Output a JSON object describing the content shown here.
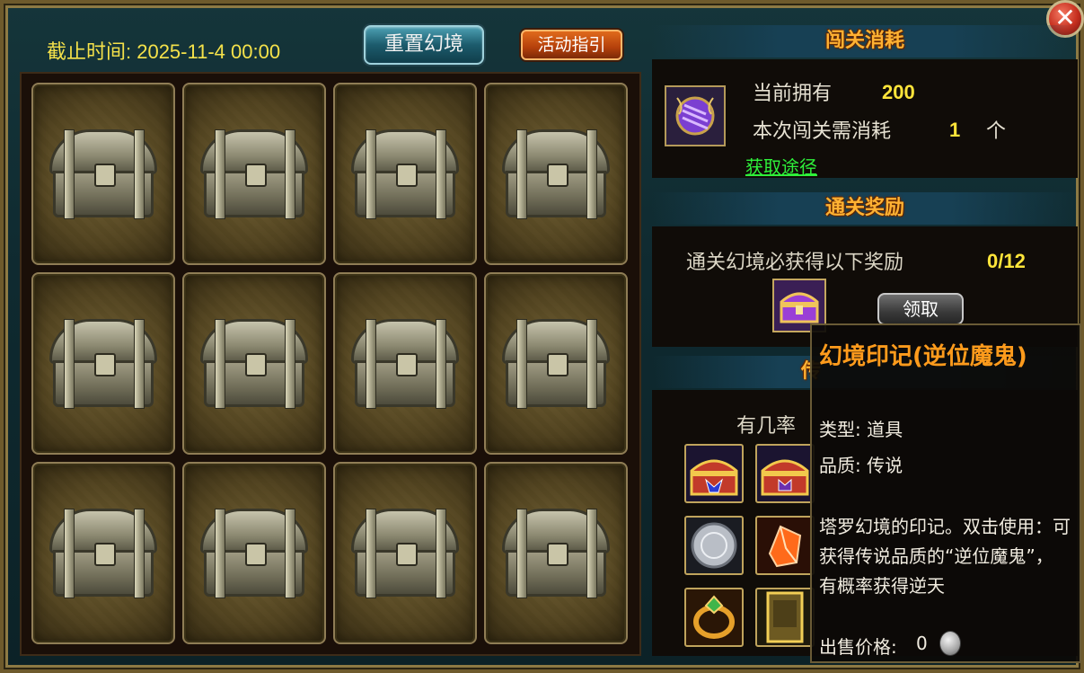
{
  "header": {
    "deadline": "截止时间: 2025-11-4 00:00",
    "reset_button": "重置幻境",
    "guide_button": "活动指引",
    "close_glyph": "✕"
  },
  "cost_section": {
    "title": "闯关消耗",
    "owned_label": "当前拥有",
    "owned_value": "200",
    "cost_label": "本次闯关需消耗",
    "cost_value": "1",
    "cost_unit": "个",
    "get_link": "获取途径",
    "item_icon": "purple-orb-seal-icon"
  },
  "reward_section": {
    "title": "通关奖励",
    "desc": "通关幻境必获得以下奖励",
    "progress": "0/12",
    "claim_button": "领取",
    "reward_icon": "purple-chest-icon"
  },
  "chance_section": {
    "title_visible": "传",
    "desc_visible": "有几率",
    "items": [
      {
        "icon": "gold-blue-chest-icon"
      },
      {
        "icon": "gold-purple-chest-icon"
      },
      {
        "icon": "silver-coin-icon"
      },
      {
        "icon": "orange-crystal-icon"
      },
      {
        "icon": "gold-ring-icon"
      },
      {
        "icon": "gold-card-icon"
      }
    ]
  },
  "chests": [
    {
      "icon": "chest-icon"
    },
    {
      "icon": "chest-icon"
    },
    {
      "icon": "chest-icon"
    },
    {
      "icon": "chest-icon"
    },
    {
      "icon": "chest-icon"
    },
    {
      "icon": "chest-icon"
    },
    {
      "icon": "chest-icon"
    },
    {
      "icon": "chest-icon"
    },
    {
      "icon": "chest-icon"
    },
    {
      "icon": "chest-icon"
    },
    {
      "icon": "chest-icon"
    },
    {
      "icon": "chest-icon"
    }
  ],
  "tooltip": {
    "title": "幻境印记(逆位魔鬼)",
    "type": "类型: 道具",
    "quality": "品质: 传说",
    "description": "塔罗幻境的印记。双击使用：可获得传说品质的“逆位魔鬼”，有概率获得逆天",
    "sell_price_label": "出售价格:",
    "sell_price_value": "0"
  },
  "colors": {
    "accent_yellow": "#ffe53a",
    "header_orange": "#ffb233",
    "link_green": "#2ef03a",
    "tooltip_title": "#ff9b1c"
  }
}
